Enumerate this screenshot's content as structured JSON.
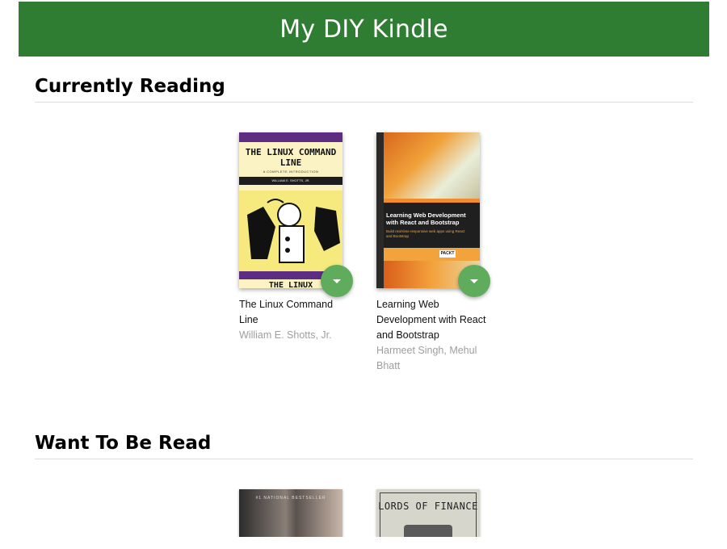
{
  "app": {
    "title": "My DIY Kindle"
  },
  "shelves": [
    {
      "title": "Currently Reading",
      "books": [
        {
          "title": "The Linux Command Line",
          "authors": "William E. Shotts, Jr.",
          "cover_text": {
            "title": "THE LINUX COMMAND LINE",
            "subtitle": "A COMPLETE INTRODUCTION",
            "author": "WILLIAM E. SHOTTS, JR.",
            "bottom": "THE LINUX"
          }
        },
        {
          "title": "Learning Web Development with React and Bootstrap",
          "authors": "Harmeet Singh, Mehul Bhatt",
          "cover_text": {
            "title": "Learning Web Development with React and Bootstrap",
            "subtitle": "Build real-time responsive web apps using React and Bootstrap",
            "publisher": "PACKT"
          }
        }
      ]
    },
    {
      "title": "Want To Be Read",
      "books": [
        {
          "cover_text": {
            "title": "#1 NATIONAL BESTSELLER"
          }
        },
        {
          "cover_text": {
            "title": "LORDS OF FINANCE"
          }
        }
      ]
    }
  ],
  "colors": {
    "header": "#2e7d32",
    "action_button": "#60ac5d",
    "author_text": "#9e9e9e"
  },
  "icons": {
    "move_button": "caret-down-icon"
  }
}
